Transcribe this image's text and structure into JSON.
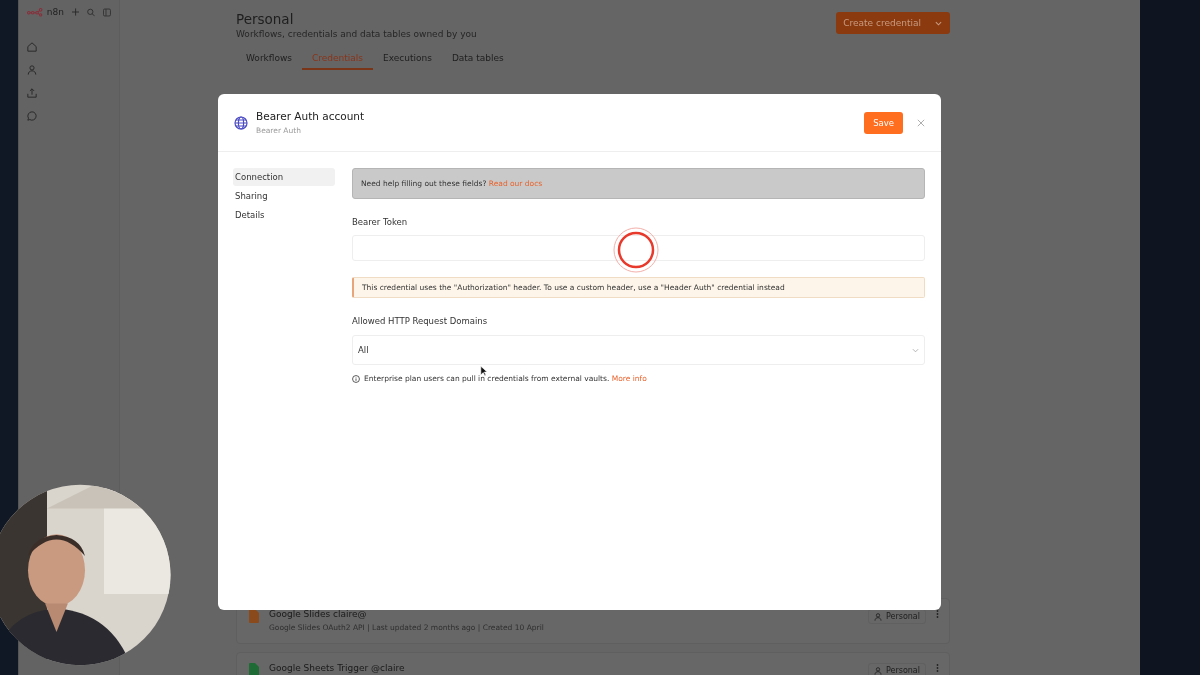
{
  "app": {
    "logo": "n8n"
  },
  "page": {
    "title": "Personal",
    "subtitle": "Workflows, credentials and data tables owned by you",
    "create_button": "Create credential"
  },
  "tabs": [
    {
      "label": "Workflows",
      "selected": false
    },
    {
      "label": "Credentials",
      "selected": true
    },
    {
      "label": "Executions",
      "selected": false
    },
    {
      "label": "Data tables",
      "selected": false
    }
  ],
  "credentials": [
    {
      "title": "Google Slides claire@",
      "subtitle": "Google Slides OAuth2 API | Last updated 2 months ago | Created 10 April",
      "owner": "Personal",
      "color": "#8a4a1c"
    },
    {
      "title": "Google Sheets Trigger @claire",
      "owner": "Personal",
      "color": "#1e6b35"
    }
  ],
  "modal": {
    "title": "Bearer Auth account",
    "subtitle": "Bearer Auth",
    "save_button": "Save",
    "nav": [
      {
        "label": "Connection",
        "selected": true
      },
      {
        "label": "Sharing",
        "selected": false
      },
      {
        "label": "Details",
        "selected": false
      }
    ],
    "help": {
      "text": "Need help filling out these fields?",
      "link": "Read our docs"
    },
    "token_label": "Bearer Token",
    "warning": "This credential uses the \"Authorization\" header. To use a custom header, use a \"Header Auth\" credential instead",
    "domains_label": "Allowed HTTP Request Domains",
    "domains_value": "All",
    "info": {
      "text": "Enterprise plan users can pull in credentials from external vaults.",
      "link": "More info"
    }
  }
}
